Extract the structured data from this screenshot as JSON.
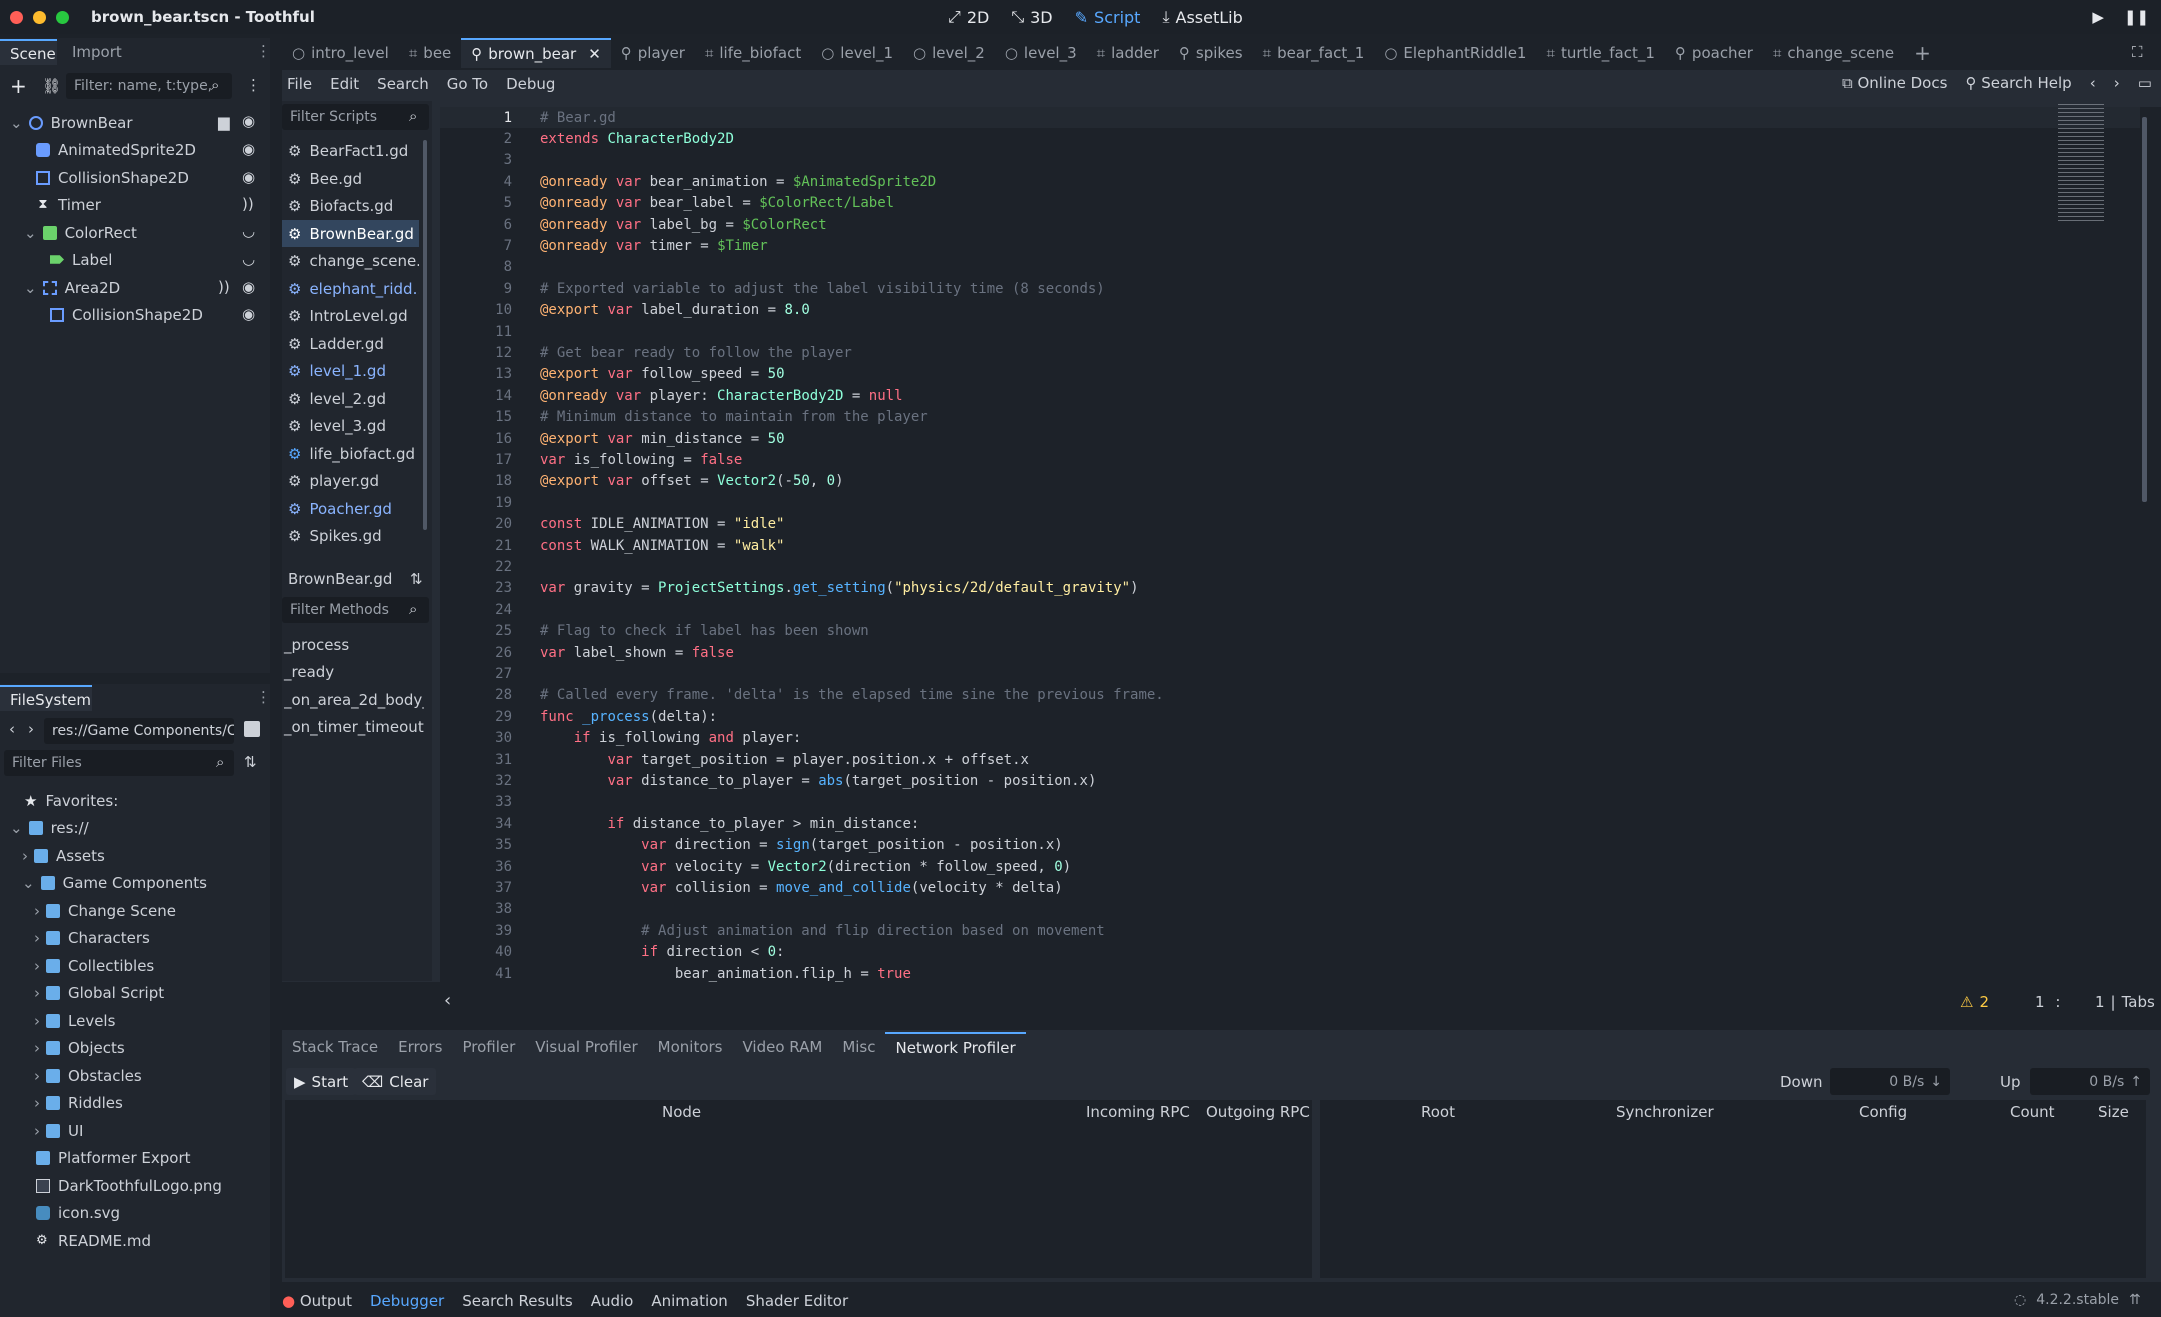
{
  "window": {
    "title": "brown_bear.tscn - Toothful",
    "controls": [
      "close",
      "minimize",
      "maximize"
    ]
  },
  "modes": [
    {
      "icon": "2d-icon",
      "label": "2D"
    },
    {
      "icon": "3d-icon",
      "label": "3D"
    },
    {
      "icon": "script-icon",
      "label": "Script"
    },
    {
      "icon": "assetlib-icon",
      "label": "AssetLib"
    }
  ],
  "scene_panel": {
    "tabs": [
      "Scene",
      "Import"
    ],
    "filter_placeholder": "Filter: name, t:type,",
    "nodes": [
      {
        "name": "BrownBear",
        "type": "CharacterBody2D"
      },
      {
        "name": "AnimatedSprite2D"
      },
      {
        "name": "CollisionShape2D"
      },
      {
        "name": "Timer"
      },
      {
        "name": "ColorRect"
      },
      {
        "name": "Label"
      },
      {
        "name": "Area2D"
      },
      {
        "name": "CollisionShape2D"
      }
    ]
  },
  "filesystem": {
    "tab": "FileSystem",
    "path": "res://Game Components/C",
    "filter_placeholder": "Filter Files",
    "favorites_label": "Favorites:",
    "root": "res://",
    "items": [
      "Assets",
      "Game Components",
      "Change Scene",
      "Characters",
      "Collectibles",
      "Global Script",
      "Levels",
      "Objects",
      "Obstacles",
      "Riddles",
      "UI",
      "Platformer Export",
      "DarkToothfulLogo.png",
      "icon.svg",
      "README.md"
    ]
  },
  "doc_tabs": [
    "intro_level",
    "bee",
    "brown_bear",
    "player",
    "life_biofact",
    "level_1",
    "level_2",
    "level_3",
    "ladder",
    "spikes",
    "bear_fact_1",
    "ElephantRiddle1",
    "turtle_fact_1",
    "poacher",
    "change_scene"
  ],
  "script_menu": [
    "File",
    "Edit",
    "Search",
    "Go To",
    "Debug"
  ],
  "help": {
    "online_docs": "Online Docs",
    "search_help": "Search Help"
  },
  "scripts": {
    "filter_placeholder": "Filter Scripts",
    "items": [
      "BearFact1.gd",
      "Bee.gd",
      "Biofacts.gd",
      "BrownBear.gd",
      "change_scene...",
      "elephant_ridd...",
      "IntroLevel.gd",
      "Ladder.gd",
      "level_1.gd",
      "level_2.gd",
      "level_3.gd",
      "life_biofact.gd",
      "player.gd",
      "Poacher.gd",
      "Spikes.gd"
    ],
    "current": "BrownBear.gd"
  },
  "methods": {
    "filter_placeholder": "Filter Methods",
    "items": [
      "_process",
      "_ready",
      "_on_area_2d_body_...",
      "_on_timer_timeout"
    ]
  },
  "code": [
    {
      "n": "1",
      "t": "# Bear.gd"
    },
    {
      "n": "2",
      "t": "extends CharacterBody2D"
    },
    {
      "n": "3",
      "t": ""
    },
    {
      "n": "4",
      "t": "@onready var bear_animation = $AnimatedSprite2D"
    },
    {
      "n": "5",
      "t": "@onready var bear_label = $ColorRect/Label"
    },
    {
      "n": "6",
      "t": "@onready var label_bg = $ColorRect"
    },
    {
      "n": "7",
      "t": "@onready var timer = $Timer"
    },
    {
      "n": "8",
      "t": ""
    },
    {
      "n": "9",
      "t": "# Exported variable to adjust the label visibility time (8 seconds)"
    },
    {
      "n": "10",
      "t": "@export var label_duration = 8.0"
    },
    {
      "n": "11",
      "t": ""
    },
    {
      "n": "12",
      "t": "# Get bear ready to follow the player"
    },
    {
      "n": "13",
      "t": "@export var follow_speed = 50"
    },
    {
      "n": "14",
      "t": "@onready var player: CharacterBody2D = null"
    },
    {
      "n": "15",
      "t": "# Minimum distance to maintain from the player"
    },
    {
      "n": "16",
      "t": "@export var min_distance = 50"
    },
    {
      "n": "17",
      "t": "var is_following = false"
    },
    {
      "n": "18",
      "t": "@export var offset = Vector2(-50, 0)"
    },
    {
      "n": "19",
      "t": ""
    },
    {
      "n": "20",
      "t": "const IDLE_ANIMATION = \"idle\""
    },
    {
      "n": "21",
      "t": "const WALK_ANIMATION = \"walk\""
    },
    {
      "n": "22",
      "t": ""
    },
    {
      "n": "23",
      "t": "var gravity = ProjectSettings.get_setting(\"physics/2d/default_gravity\")"
    },
    {
      "n": "24",
      "t": ""
    },
    {
      "n": "25",
      "t": "# Flag to check if label has been shown"
    },
    {
      "n": "26",
      "t": "var label_shown = false"
    },
    {
      "n": "27",
      "t": ""
    },
    {
      "n": "28",
      "t": "# Called every frame. 'delta' is the elapsed time sine the previous frame."
    },
    {
      "n": "29",
      "t": "func _process(delta):"
    },
    {
      "n": "30",
      "t": "    if is_following and player:"
    },
    {
      "n": "31",
      "t": "        var target_position = player.position.x + offset.x"
    },
    {
      "n": "32",
      "t": "        var distance_to_player = abs(target_position - position.x)"
    },
    {
      "n": "33",
      "t": ""
    },
    {
      "n": "34",
      "t": "        if distance_to_player > min_distance:"
    },
    {
      "n": "35",
      "t": "            var direction = sign(target_position - position.x)"
    },
    {
      "n": "36",
      "t": "            var velocity = Vector2(direction * follow_speed, 0)"
    },
    {
      "n": "37",
      "t": "            var collision = move_and_collide(velocity * delta)"
    },
    {
      "n": "38",
      "t": ""
    },
    {
      "n": "39",
      "t": "            # Adjust animation and flip direction based on movement"
    },
    {
      "n": "40",
      "t": "            if direction < 0:"
    },
    {
      "n": "41",
      "t": "                bear_animation.flip_h = true"
    }
  ],
  "editor_status": {
    "warnings": "2",
    "line": "1",
    "col": "1",
    "indent": "Tabs"
  },
  "debugger": {
    "tabs": [
      "Stack Trace",
      "Errors",
      "Profiler",
      "Visual Profiler",
      "Monitors",
      "Video RAM",
      "Misc",
      "Network Profiler"
    ],
    "active": "Network Profiler",
    "start": "Start",
    "clear": "Clear",
    "down_label": "Down",
    "down_value": "0 B/s",
    "up_label": "Up",
    "up_value": "0 B/s",
    "left_columns": [
      "Node",
      "Incoming RPC",
      "Outgoing RPC"
    ],
    "right_columns": [
      "Root",
      "Synchronizer",
      "Config",
      "Count",
      "Size"
    ]
  },
  "bottom_panel_tabs": [
    "Output",
    "Debugger",
    "Search Results",
    "Audio",
    "Animation",
    "Shader Editor"
  ],
  "version": "4.2.2.stable",
  "colors": {
    "accent": "#58a8ff",
    "bg": "#1d2229",
    "panel": "#21262e",
    "comment": "#6a7280",
    "keyword": "#ff7085",
    "string": "#ffeda1",
    "type": "#8effda",
    "number": "#a1ffe0",
    "function": "#57b3ff"
  }
}
